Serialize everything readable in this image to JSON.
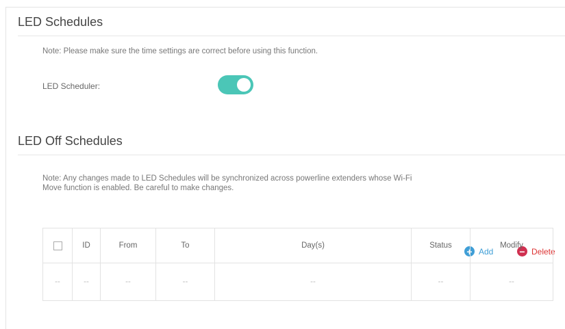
{
  "led_schedules": {
    "title": "LED Schedules",
    "note": "Note: Please make sure the time settings are correct before using this function.",
    "scheduler_label": "LED Scheduler:",
    "scheduler_enabled": true
  },
  "led_off_schedules": {
    "title": "LED Off Schedules",
    "note_line1": "Note: Any changes made to LED Schedules will be synchronized across powerline extenders whose Wi-Fi",
    "note_line2": "Move function is enabled. Be careful to make changes.",
    "add_label": "Add",
    "delete_label": "Delete",
    "table": {
      "headers": {
        "id": "ID",
        "from": "From",
        "to": "To",
        "days": "Day(s)",
        "status": "Status",
        "modify": "Modify"
      },
      "empty_row": {
        "select": "--",
        "id": "--",
        "from": "--",
        "to": "--",
        "days": "--",
        "status": "--",
        "modify": "--"
      }
    }
  },
  "colors": {
    "toggle_on": "#4bc6b7",
    "add_accent": "#3f9ed6",
    "delete_accent": "#d03050"
  }
}
